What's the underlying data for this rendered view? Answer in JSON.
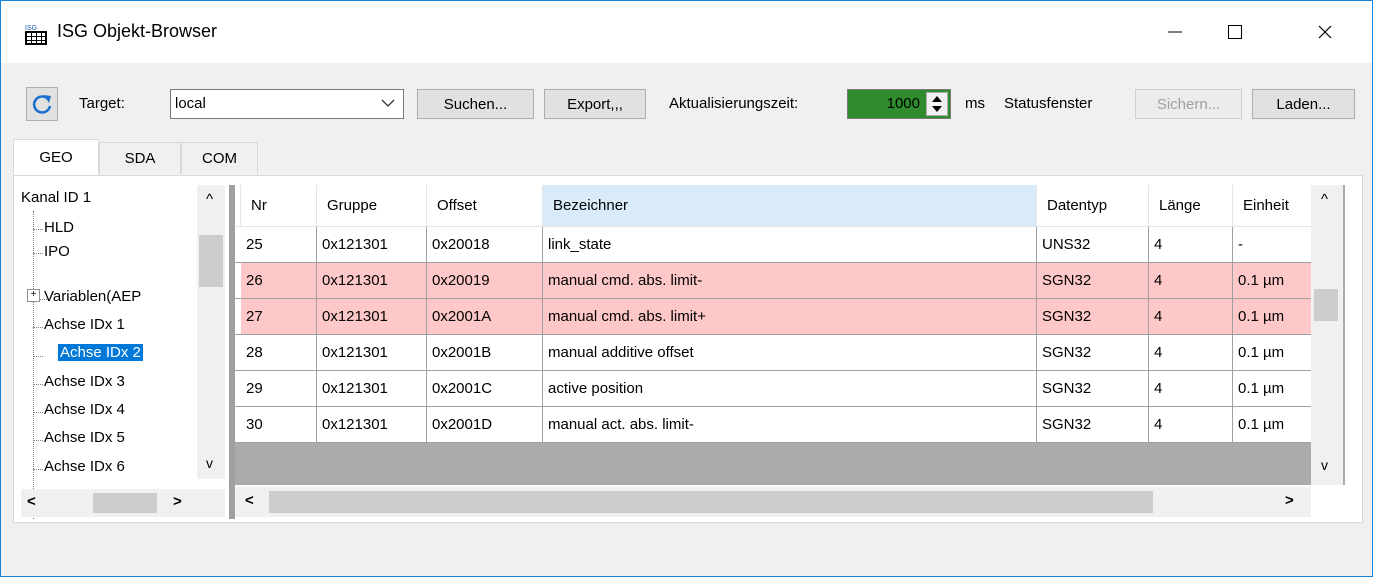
{
  "window": {
    "title": "ISG Objekt-Browser",
    "icon_text": "ISG",
    "minimize": "—",
    "maximize": "☐",
    "close": "✕"
  },
  "toolbar": {
    "refresh_icon": "refresh-icon",
    "target_label": "Target:",
    "target_value": "local",
    "search_label": "Suchen...",
    "export_label": "Export,,,",
    "update_label": "Aktualisierungszeit:",
    "update_value": "1000",
    "update_unit": "ms",
    "status_label": "Statusfenster",
    "save_label": "Sichern...",
    "load_label": "Laden...",
    "update_color": "#2e8b2e"
  },
  "tabs": [
    {
      "label": "GEO"
    },
    {
      "label": "SDA"
    },
    {
      "label": "COM"
    }
  ],
  "tree": {
    "items": [
      {
        "label": "Kanal ID 1"
      },
      {
        "label": "HLD"
      },
      {
        "label": "IPO"
      },
      {
        "label": "Variablen(AEP"
      },
      {
        "label": "Achse IDx 1"
      },
      {
        "label": "Achse IDx 2"
      },
      {
        "label": "Achse IDx 3"
      },
      {
        "label": "Achse IDx 4"
      },
      {
        "label": "Achse IDx 5"
      },
      {
        "label": "Achse IDx 6"
      }
    ],
    "expander": "⊞",
    "selected_color": "#0078d7"
  },
  "grid": {
    "columns": [
      "Nr",
      "Gruppe",
      "Offset",
      "Bezeichner",
      "Datentyp",
      "Länge",
      "Einheit"
    ],
    "rows": [
      {
        "cells": [
          "25",
          "0x121301",
          "0x20018",
          "link_state",
          "UNS32",
          "4",
          "-"
        ],
        "highlight": false
      },
      {
        "cells": [
          "26",
          "0x121301",
          "0x20019",
          "manual cmd. abs. limit-",
          "SGN32",
          "4",
          "0.1 µm"
        ],
        "highlight": true
      },
      {
        "cells": [
          "27",
          "0x121301",
          "0x2001A",
          "manual cmd. abs. limit+",
          "SGN32",
          "4",
          "0.1 µm"
        ],
        "highlight": true
      },
      {
        "cells": [
          "28",
          "0x121301",
          "0x2001B",
          "manual additive offset",
          "SGN32",
          "4",
          "0.1 µm"
        ],
        "highlight": false
      },
      {
        "cells": [
          "29",
          "0x121301",
          "0x2001C",
          "active position",
          "SGN32",
          "4",
          "0.1 µm"
        ],
        "highlight": false
      },
      {
        "cells": [
          "30",
          "0x121301",
          "0x2001D",
          "manual act. abs. limit-",
          "SGN32",
          "4",
          "0.1 µm"
        ],
        "highlight": false
      }
    ],
    "highlight_color": "#ffc8c8",
    "selected_header_color": "#d9ebf9"
  },
  "scroll": {
    "up": "^",
    "down": "v",
    "left": "<",
    "right": ">"
  }
}
